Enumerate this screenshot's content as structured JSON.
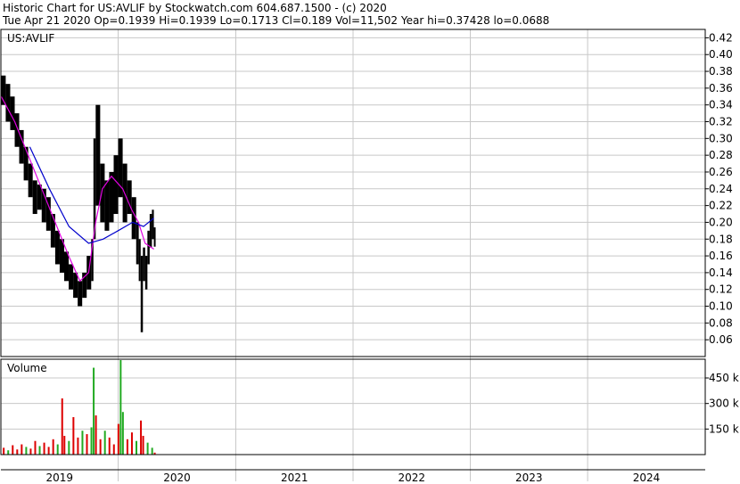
{
  "header": {
    "line1": "Historic Chart for US:AVLIF by Stockwatch.com 604.687.1500 - (c) 2020",
    "line2": "Tue Apr 21 2020   Op=0.1939   Hi=0.1939   Lo=0.1713   Cl=0.189   Vol=11,502   Year hi=0.37428   lo=0.0688"
  },
  "panels": {
    "price_label": "US:AVLIF",
    "volume_label": "Volume"
  },
  "colors": {
    "background": "#ffffff",
    "grid": "#c8c8c8",
    "frame": "#000000",
    "price_bar": "#000000",
    "ma_short": "#e000e0",
    "ma_long": "#0000cc",
    "volume_up": "#22aa22",
    "volume_down": "#dd0000"
  },
  "chart_data": [
    {
      "type": "line",
      "subtype": "ohlc-bars",
      "symbol": "US:AVLIF",
      "grid": true,
      "y_axis_side": "right",
      "ylim": [
        0.04,
        0.43
      ],
      "yticks": [
        0.06,
        0.08,
        0.1,
        0.12,
        0.14,
        0.16,
        0.18,
        0.2,
        0.22,
        0.24,
        0.26,
        0.28,
        0.3,
        0.32,
        0.34,
        0.36,
        0.38,
        0.4,
        0.42
      ],
      "ytick_labels": [
        "0.06",
        "0.08",
        "0.10",
        "0.12",
        "0.14",
        "0.16",
        "0.18",
        "0.20",
        "0.22",
        "0.24",
        "0.26",
        "0.28",
        "0.30",
        "0.32",
        "0.34",
        "0.36",
        "0.38",
        "0.40",
        "0.42"
      ],
      "xlim": [
        "2019-01-01",
        "2025-01-01"
      ],
      "years": [
        "2019",
        "2020",
        "2021",
        "2022",
        "2023",
        "2024"
      ],
      "year_starts": [
        "2019-01-01",
        "2020-01-01",
        "2021-01-01",
        "2022-01-01",
        "2023-01-01",
        "2024-01-01"
      ],
      "series": [
        {
          "kind": "price",
          "points": [
            [
              "2019-01-02",
              0.34,
              0.375
            ],
            [
              "2019-01-16",
              0.32,
              0.365
            ],
            [
              "2019-01-30",
              0.31,
              0.35
            ],
            [
              "2019-02-13",
              0.29,
              0.33
            ],
            [
              "2019-02-27",
              0.27,
              0.31
            ],
            [
              "2019-03-13",
              0.25,
              0.29
            ],
            [
              "2019-03-27",
              0.23,
              0.27
            ],
            [
              "2019-04-10",
              0.21,
              0.25
            ],
            [
              "2019-04-24",
              0.215,
              0.245
            ],
            [
              "2019-05-08",
              0.2,
              0.24
            ],
            [
              "2019-05-22",
              0.19,
              0.23
            ],
            [
              "2019-06-05",
              0.17,
              0.21
            ],
            [
              "2019-06-19",
              0.15,
              0.19
            ],
            [
              "2019-07-03",
              0.14,
              0.18
            ],
            [
              "2019-07-17",
              0.13,
              0.165
            ],
            [
              "2019-07-31",
              0.12,
              0.15
            ],
            [
              "2019-08-14",
              0.11,
              0.14
            ],
            [
              "2019-08-28",
              0.1,
              0.13
            ],
            [
              "2019-09-11",
              0.11,
              0.14
            ],
            [
              "2019-09-25",
              0.12,
              0.16
            ],
            [
              "2019-10-09",
              0.13,
              0.18
            ],
            [
              "2019-10-16",
              0.18,
              0.3
            ],
            [
              "2019-10-23",
              0.22,
              0.34
            ],
            [
              "2019-11-06",
              0.2,
              0.27
            ],
            [
              "2019-11-20",
              0.19,
              0.25
            ],
            [
              "2019-12-04",
              0.2,
              0.26
            ],
            [
              "2019-12-18",
              0.21,
              0.28
            ],
            [
              "2020-01-01",
              0.23,
              0.3
            ],
            [
              "2020-01-15",
              0.2,
              0.27
            ],
            [
              "2020-01-29",
              0.21,
              0.25
            ],
            [
              "2020-02-12",
              0.18,
              0.23
            ],
            [
              "2020-02-26",
              0.15,
              0.2
            ],
            [
              "2020-03-05",
              0.13,
              0.18
            ],
            [
              "2020-03-11",
              0.069,
              0.16
            ],
            [
              "2020-03-18",
              0.13,
              0.17
            ],
            [
              "2020-03-25",
              0.12,
              0.16
            ],
            [
              "2020-04-01",
              0.15,
              0.19
            ],
            [
              "2020-04-08",
              0.17,
              0.21
            ],
            [
              "2020-04-15",
              0.18,
              0.215
            ],
            [
              "2020-04-21",
              0.171,
              0.194
            ]
          ]
        },
        {
          "kind": "ma_short",
          "points": [
            [
              "2019-01-02",
              0.35
            ],
            [
              "2019-02-13",
              0.32
            ],
            [
              "2019-03-27",
              0.28
            ],
            [
              "2019-05-08",
              0.24
            ],
            [
              "2019-06-19",
              0.2
            ],
            [
              "2019-07-31",
              0.16
            ],
            [
              "2019-09-04",
              0.13
            ],
            [
              "2019-10-01",
              0.14
            ],
            [
              "2019-10-23",
              0.2
            ],
            [
              "2019-11-13",
              0.24
            ],
            [
              "2019-12-11",
              0.255
            ],
            [
              "2020-01-15",
              0.24
            ],
            [
              "2020-02-12",
              0.215
            ],
            [
              "2020-03-04",
              0.2
            ],
            [
              "2020-03-25",
              0.175
            ],
            [
              "2020-04-21",
              0.168
            ]
          ]
        },
        {
          "kind": "ma_long",
          "points": [
            [
              "2019-04-01",
              0.29
            ],
            [
              "2019-06-01",
              0.24
            ],
            [
              "2019-08-01",
              0.195
            ],
            [
              "2019-10-01",
              0.175
            ],
            [
              "2019-11-15",
              0.18
            ],
            [
              "2020-01-01",
              0.19
            ],
            [
              "2020-02-15",
              0.2
            ],
            [
              "2020-03-20",
              0.195
            ],
            [
              "2020-04-21",
              0.205
            ]
          ]
        }
      ]
    },
    {
      "type": "bar",
      "name": "Volume",
      "y_axis_side": "right",
      "ylim": [
        0,
        560000
      ],
      "yticks": [
        150000,
        300000,
        450000
      ],
      "ytick_labels": [
        "150 k",
        "300 k",
        "450 k"
      ],
      "bars": [
        [
          "2019-01-07",
          40000,
          "down"
        ],
        [
          "2019-01-21",
          25000,
          "up"
        ],
        [
          "2019-02-04",
          55000,
          "down"
        ],
        [
          "2019-02-18",
          30000,
          "down"
        ],
        [
          "2019-03-04",
          60000,
          "down"
        ],
        [
          "2019-03-18",
          45000,
          "up"
        ],
        [
          "2019-04-01",
          35000,
          "down"
        ],
        [
          "2019-04-15",
          80000,
          "down"
        ],
        [
          "2019-04-29",
          50000,
          "up"
        ],
        [
          "2019-05-13",
          70000,
          "down"
        ],
        [
          "2019-05-27",
          45000,
          "down"
        ],
        [
          "2019-06-10",
          90000,
          "down"
        ],
        [
          "2019-06-24",
          60000,
          "up"
        ],
        [
          "2019-07-08",
          330000,
          "down"
        ],
        [
          "2019-07-15",
          110000,
          "down"
        ],
        [
          "2019-07-29",
          80000,
          "up"
        ],
        [
          "2019-08-12",
          220000,
          "down"
        ],
        [
          "2019-08-26",
          100000,
          "down"
        ],
        [
          "2019-09-09",
          140000,
          "up"
        ],
        [
          "2019-09-23",
          120000,
          "down"
        ],
        [
          "2019-10-07",
          160000,
          "up"
        ],
        [
          "2019-10-14",
          510000,
          "up"
        ],
        [
          "2019-10-21",
          230000,
          "down"
        ],
        [
          "2019-11-04",
          90000,
          "down"
        ],
        [
          "2019-11-18",
          140000,
          "up"
        ],
        [
          "2019-12-02",
          100000,
          "down"
        ],
        [
          "2019-12-16",
          60000,
          "down"
        ],
        [
          "2019-12-30",
          180000,
          "down"
        ],
        [
          "2020-01-06",
          630000,
          "up"
        ],
        [
          "2020-01-13",
          250000,
          "up"
        ],
        [
          "2020-01-27",
          90000,
          "down"
        ],
        [
          "2020-02-10",
          130000,
          "down"
        ],
        [
          "2020-02-24",
          80000,
          "up"
        ],
        [
          "2020-03-09",
          200000,
          "down"
        ],
        [
          "2020-03-16",
          110000,
          "down"
        ],
        [
          "2020-03-30",
          70000,
          "up"
        ],
        [
          "2020-04-13",
          40000,
          "up"
        ],
        [
          "2020-04-21",
          11502,
          "down"
        ]
      ]
    }
  ]
}
